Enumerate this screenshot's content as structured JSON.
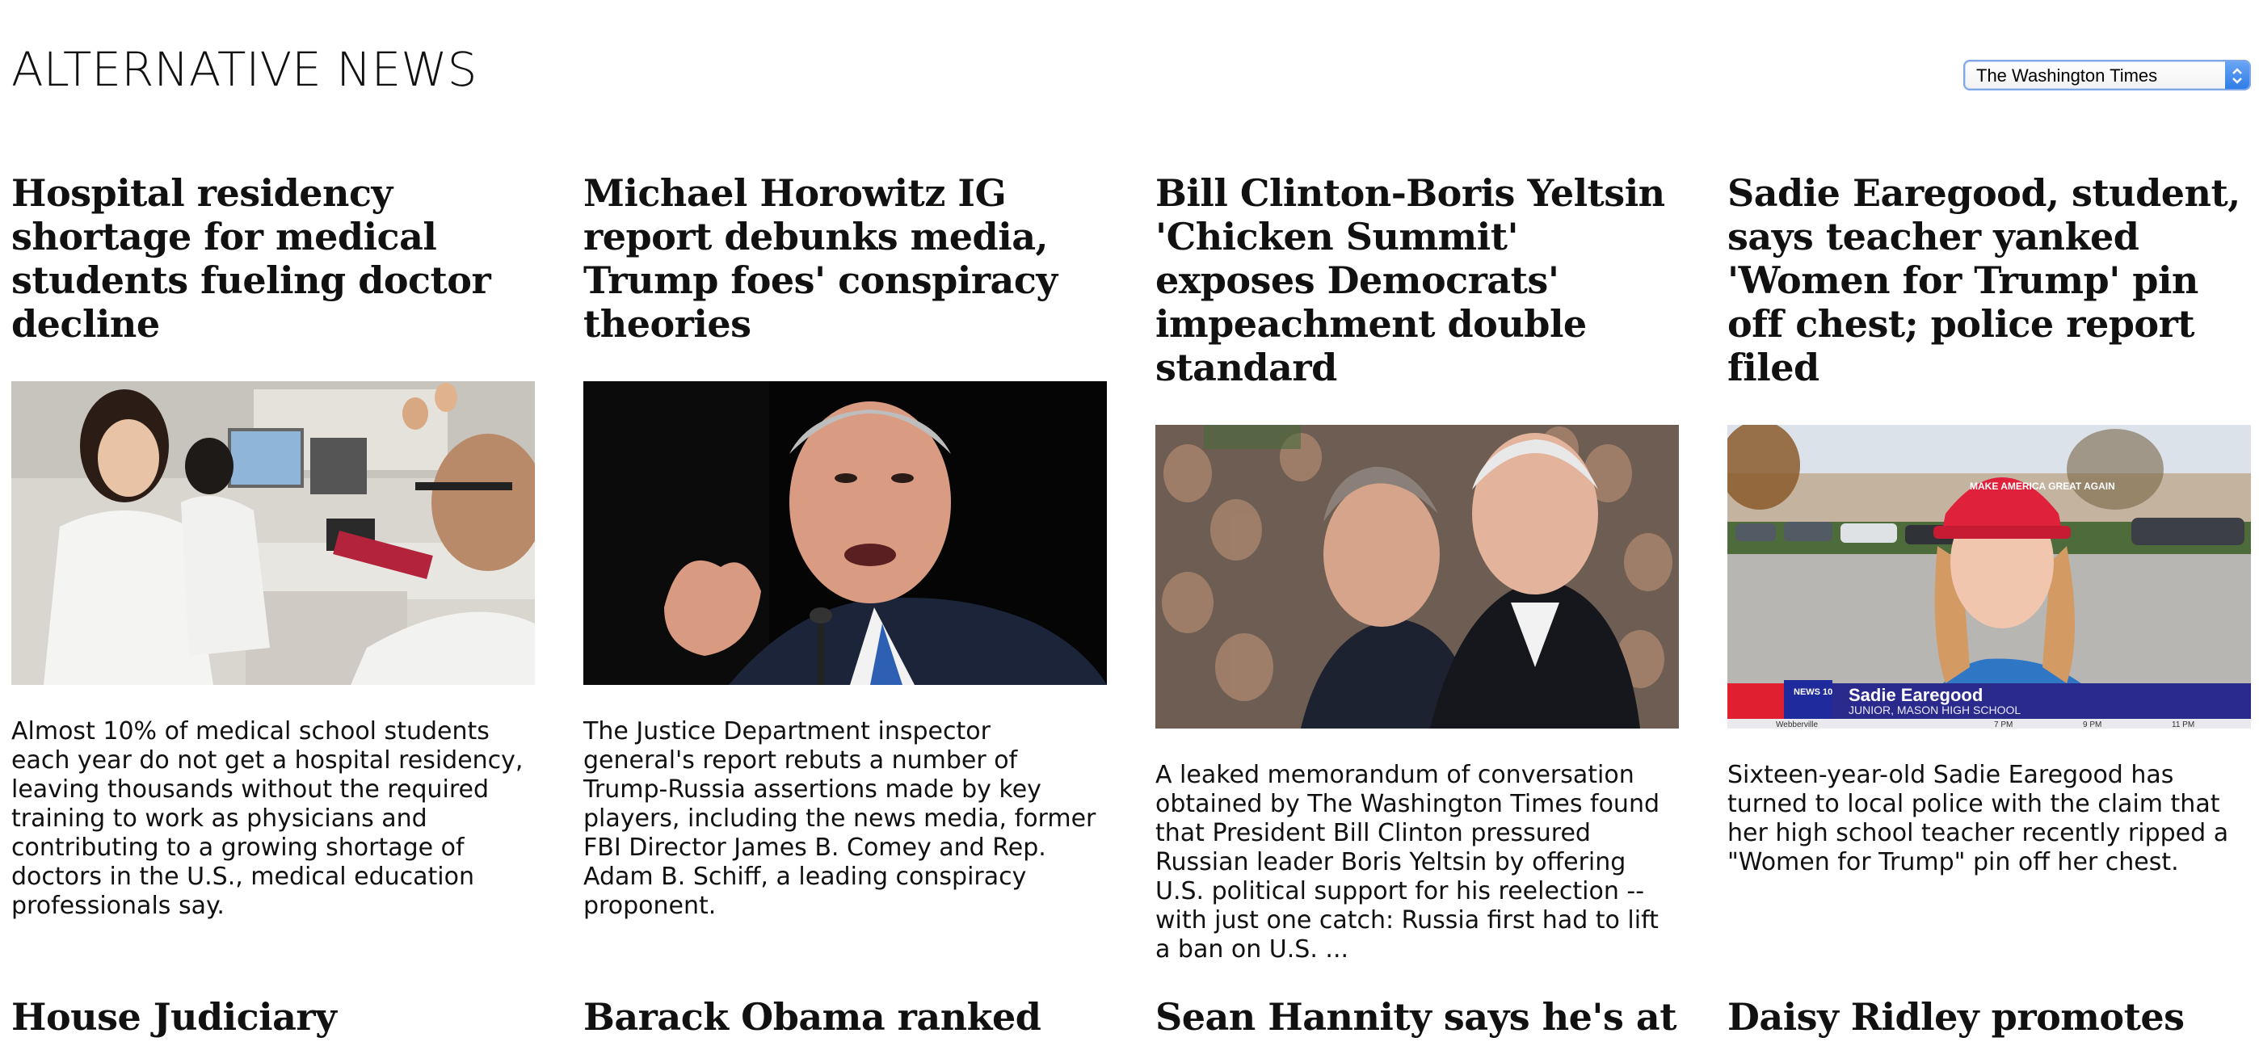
{
  "site": {
    "title": "ALTERNATIVE NEWS"
  },
  "source_select": {
    "selected": "The Washington Times"
  },
  "articles": [
    {
      "headline": "Hospital residency shortage for medical students fueling doctor decline",
      "summary": "Almost 10% of medical school students each year do not get a hospital residency, leaving thousands without the required training to work as physicians and contributing to a growing shortage of doctors in the U.S., medical education professionals say."
    },
    {
      "headline": "Michael Horowitz IG report debunks media, Trump foes' conspiracy theories",
      "summary": "The Justice Department inspector general's report rebuts a number of Trump-Russia assertions made by key players, including the news media, former FBI Director James B. Comey and Rep. Adam B. Schiff, a leading conspiracy proponent."
    },
    {
      "headline": "Bill Clinton-Boris Yeltsin 'Chicken Summit' exposes Democrats' impeachment double standard",
      "summary": "A leaked memorandum of conversation obtained by The Washington Times found that President Bill Clinton pressured Russian leader Boris Yeltsin by offering U.S. political support for his reelection -- with just one catch: Russia first had to lift a ban on U.S. ..."
    },
    {
      "headline": "Sadie Earegood, student, says teacher yanked 'Women for Trump' pin off chest; police report filed",
      "summary": "Sixteen-year-old Sadie Earegood has turned to local police with the claim that her high school teacher recently ripped a \"Women for Trump\" pin off her chest.",
      "photo_caption_name": "Sadie Earegood",
      "photo_caption_sub": "JUNIOR, MASON HIGH SCHOOL",
      "photo_channel": "NEWS 10",
      "photo_cap_text": "MAKE AMERICA GREAT AGAIN",
      "photo_town": "Webberville",
      "photo_times": [
        "7 PM",
        "9 PM",
        "11 PM"
      ]
    }
  ],
  "articles_row2": [
    {
      "headline": "House Judiciary"
    },
    {
      "headline": "Barack Obama ranked"
    },
    {
      "headline": "Sean Hannity says he's at"
    },
    {
      "headline": "Daisy Ridley promotes"
    }
  ]
}
